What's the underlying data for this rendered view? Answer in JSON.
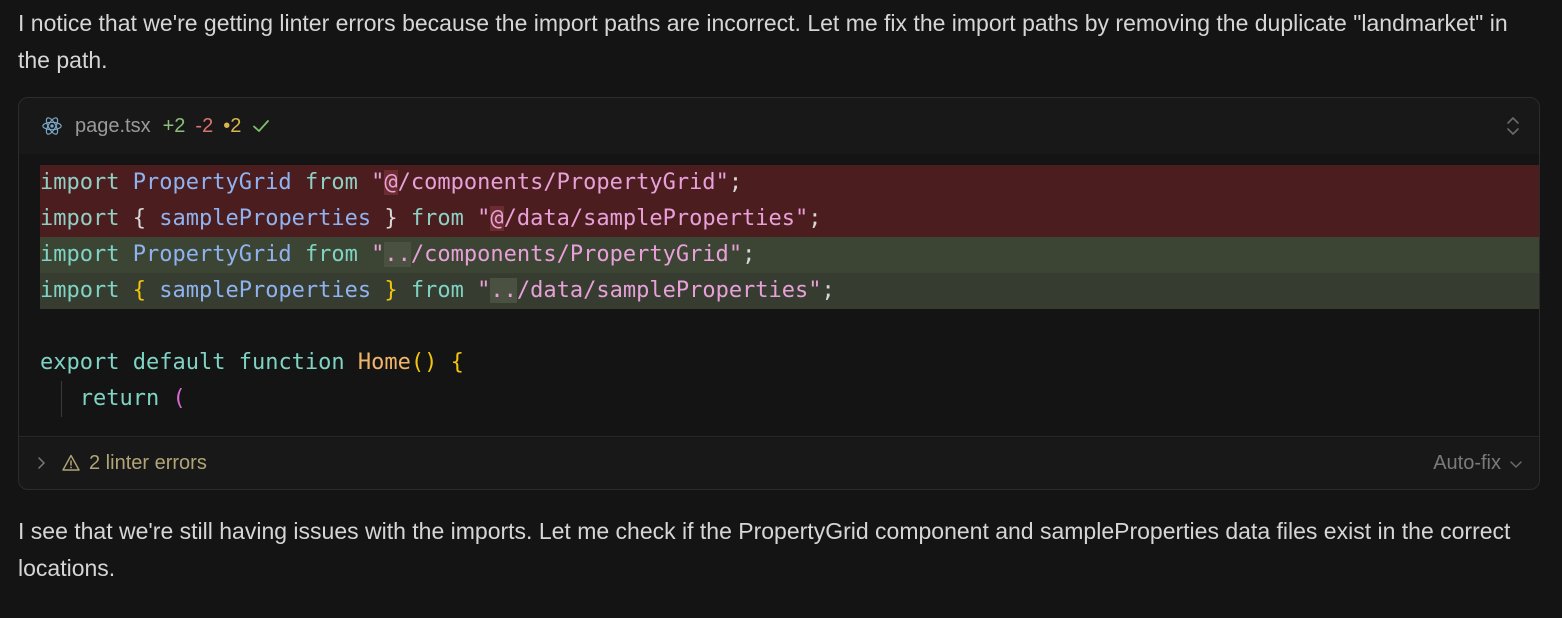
{
  "messages": {
    "before": "I notice that we're getting linter errors because the import paths are incorrect. Let me fix the import paths by removing the duplicate \"landmarket\" in the path.",
    "after": "I see that we're still having issues with the imports. Let me check if the PropertyGrid component and sampleProperties data files exist in the correct locations."
  },
  "diff_card": {
    "file_name": "page.tsx",
    "added": "+2",
    "removed": "-2",
    "modified": "•2",
    "icons": {
      "file": "react-icon",
      "status": "check-icon",
      "expand": "expand-collapse-icon"
    },
    "colors": {
      "removed_bg": "#4b1d1f",
      "added_bg": "#363c2f",
      "added_count": "#8ebf7a",
      "removed_count": "#d9736f",
      "modified_count": "#d9b54e"
    },
    "lines": {
      "r1": {
        "kw_import": "import",
        "ident": "PropertyGrid",
        "kw_from": "from",
        "q_open": "\"",
        "hl": "@",
        "path": "/components/PropertyGrid",
        "q_close": "\"",
        "semi": ";"
      },
      "r2": {
        "kw_import": "import",
        "brace_open": "{",
        "ident": "sampleProperties",
        "brace_close": "}",
        "kw_from": "from",
        "q_open": "\"",
        "hl": "@",
        "path": "/data/sampleProperties",
        "q_close": "\"",
        "semi": ";"
      },
      "a1": {
        "kw_import": "import",
        "ident": "PropertyGrid",
        "kw_from": "from",
        "q_open": "\"",
        "hl": "..",
        "path": "/components/PropertyGrid",
        "q_close": "\"",
        "semi": ";"
      },
      "a2": {
        "kw_import": "import",
        "brace_open": "{",
        "ident": "sampleProperties",
        "brace_close": "}",
        "kw_from": "from",
        "q_open": "\"",
        "hl": "..",
        "path": "/data/sampleProperties",
        "q_close": "\"",
        "semi": ";"
      },
      "c1": {
        "kw_export": "export",
        "kw_default": "default",
        "kw_function": "function",
        "fn_name": "Home",
        "parens": "()",
        "brace_open": "{"
      },
      "c2": {
        "kw_return": "return",
        "paren": "("
      }
    },
    "footer": {
      "lint_label": "2 linter errors",
      "autofix_label": "Auto-fix",
      "icons": {
        "toggle": "chevron-right-icon",
        "warning": "warning-icon",
        "dropdown": "chevron-down-icon"
      }
    }
  }
}
